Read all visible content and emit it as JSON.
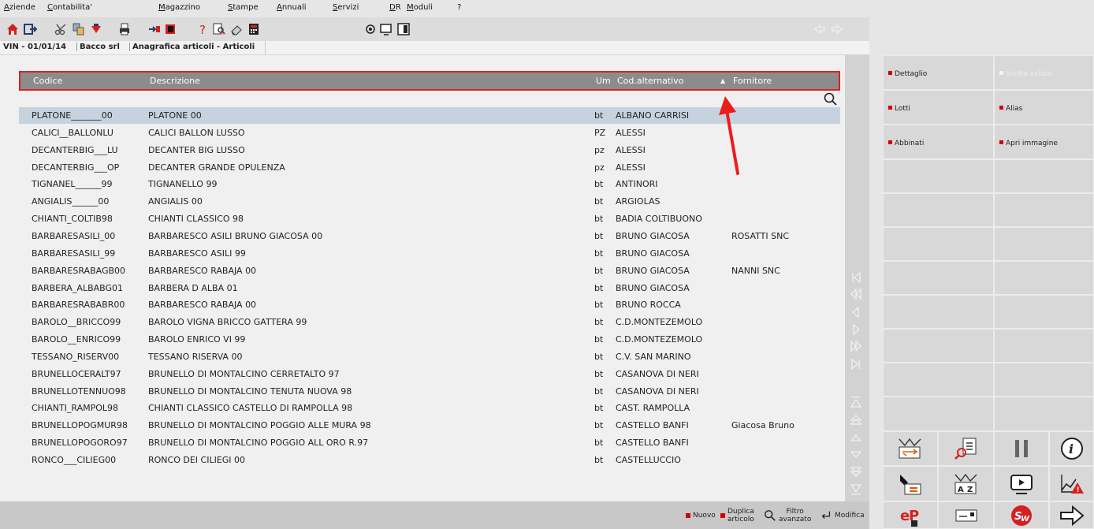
{
  "menu": [
    "Aziende",
    "Contabilita'",
    "Magazzino",
    "Stampe",
    "Annuali",
    "Servizi",
    "DR",
    "Moduli",
    "?"
  ],
  "breadcrumb": {
    "context": "VIN - 01/01/14",
    "company": "Bacco srl",
    "module": "Anagrafica articoli - Articoli"
  },
  "table": {
    "columns": {
      "codice": "Codice",
      "descrizione": "Descrizione",
      "um": "Um",
      "cod_alternativo": "Cod.alternativo",
      "fornitore": "Fornitore"
    },
    "sort_indicator": "▲",
    "rows": [
      {
        "codice": "PLATONE_______00",
        "descrizione": "PLATONE 00",
        "um": "bt",
        "cod_alternativo": "ALBANO CARRISI",
        "fornitore": ""
      },
      {
        "codice": "CALICI__BALLONLU",
        "descrizione": "CALICI BALLON LUSSO",
        "um": "PZ",
        "cod_alternativo": "ALESSI",
        "fornitore": ""
      },
      {
        "codice": "DECANTERBIG___LU",
        "descrizione": "DECANTER BIG LUSSO",
        "um": "pz",
        "cod_alternativo": "ALESSI",
        "fornitore": ""
      },
      {
        "codice": "DECANTERBIG___OP",
        "descrizione": "DECANTER GRANDE OPULENZA",
        "um": "pz",
        "cod_alternativo": "ALESSI",
        "fornitore": ""
      },
      {
        "codice": "TIGNANEL______99",
        "descrizione": "TIGNANELLO 99",
        "um": "bt",
        "cod_alternativo": "ANTINORI",
        "fornitore": ""
      },
      {
        "codice": "ANGIALIS______00",
        "descrizione": "ANGIALIS 00",
        "um": "bt",
        "cod_alternativo": "ARGIOLAS",
        "fornitore": ""
      },
      {
        "codice": "CHIANTI_COLTIB98",
        "descrizione": "CHIANTI CLASSICO 98",
        "um": "bt",
        "cod_alternativo": "BADIA COLTIBUONO",
        "fornitore": ""
      },
      {
        "codice": "BARBARESASILI_00",
        "descrizione": "BARBARESCO ASILI BRUNO GIACOSA 00",
        "um": "bt",
        "cod_alternativo": "BRUNO GIACOSA",
        "fornitore": "ROSATTI SNC"
      },
      {
        "codice": "BARBARESASILI_99",
        "descrizione": "BARBARESCO ASILI 99",
        "um": "bt",
        "cod_alternativo": "BRUNO GIACOSA",
        "fornitore": ""
      },
      {
        "codice": "BARBARESRABAGB00",
        "descrizione": "BARBARESCO RABAJA 00",
        "um": "bt",
        "cod_alternativo": "BRUNO GIACOSA",
        "fornitore": "NANNI SNC"
      },
      {
        "codice": "BARBERA_ALBABG01",
        "descrizione": "BARBERA D ALBA 01",
        "um": "bt",
        "cod_alternativo": "BRUNO GIACOSA",
        "fornitore": ""
      },
      {
        "codice": "BARBARESRABABR00",
        "descrizione": "BARBARESCO RABAJA 00",
        "um": "bt",
        "cod_alternativo": "BRUNO ROCCA",
        "fornitore": ""
      },
      {
        "codice": "BAROLO__BRICCO99",
        "descrizione": "BAROLO VIGNA BRICCO GATTERA 99",
        "um": "bt",
        "cod_alternativo": "C.D.MONTEZEMOLO",
        "fornitore": ""
      },
      {
        "codice": "BAROLO__ENRICO99",
        "descrizione": "BAROLO ENRICO VI 99",
        "um": "bt",
        "cod_alternativo": "C.D.MONTEZEMOLO",
        "fornitore": ""
      },
      {
        "codice": "TESSANO_RISERV00",
        "descrizione": "TESSANO RISERVA 00",
        "um": "bt",
        "cod_alternativo": "C.V. SAN MARINO",
        "fornitore": ""
      },
      {
        "codice": "BRUNELLOCERALT97",
        "descrizione": "BRUNELLO DI MONTALCINO CERRETALTO 97",
        "um": "bt",
        "cod_alternativo": "CASANOVA DI NERI",
        "fornitore": ""
      },
      {
        "codice": "BRUNELLOTENNUO98",
        "descrizione": "BRUNELLO DI MONTALCINO TENUTA NUOVA 98",
        "um": "bt",
        "cod_alternativo": "CASANOVA DI NERI",
        "fornitore": ""
      },
      {
        "codice": "CHIANTI_RAMPOL98",
        "descrizione": "CHIANTI CLASSICO CASTELLO DI RAMPOLLA 98",
        "um": "bt",
        "cod_alternativo": "CAST. RAMPOLLA",
        "fornitore": ""
      },
      {
        "codice": "BRUNELLOPOGMUR98",
        "descrizione": "BRUNELLO DI MONTALCINO POGGIO ALLE MURA 98",
        "um": "bt",
        "cod_alternativo": "CASTELLO BANFI",
        "fornitore": "Giacosa Bruno"
      },
      {
        "codice": "BRUNELLOPOGORO97",
        "descrizione": "BRUNELLO DI MONTALCINO POGGIO ALL ORO R.97",
        "um": "bt",
        "cod_alternativo": "CASTELLO BANFI",
        "fornitore": ""
      },
      {
        "codice": "RONCO___CILIEG00",
        "descrizione": "RONCO DEI CILIEGI 00",
        "um": "bt",
        "cod_alternativo": "CASTELLUCCIO",
        "fornitore": ""
      }
    ]
  },
  "side_actions": [
    {
      "label": "Dettaglio",
      "enabled": true
    },
    {
      "label": "Scelta valuta",
      "enabled": false
    },
    {
      "label": "Lotti",
      "enabled": true
    },
    {
      "label": "Alias",
      "enabled": true
    },
    {
      "label": "Abbinati",
      "enabled": true
    },
    {
      "label": "Apri immagine",
      "enabled": true
    }
  ],
  "bottom_actions": {
    "nuovo": "Nuovo",
    "duplica_1": "Duplica",
    "duplica_2": "articolo",
    "filtro_1": "Filtro",
    "filtro_2": "avanzato",
    "modifica": "Modifica"
  },
  "colors": {
    "accent_red": "#d20000",
    "header_bg": "#8c8c8c",
    "selected_row": "#c7d2df",
    "header_border": "#e02020"
  }
}
